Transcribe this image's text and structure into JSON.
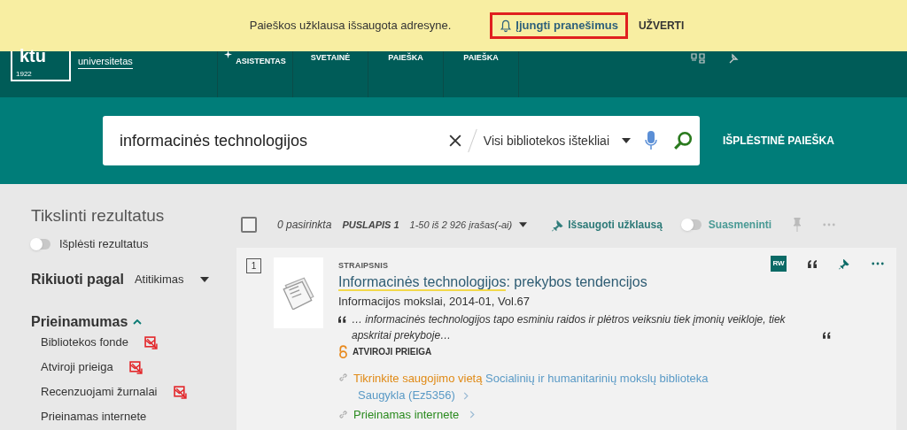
{
  "banner": {
    "message": "Paieškos užklausa išsaugota adresyne.",
    "notify_button": "Įjungti pranešimus",
    "close_button": "UŽVERTI"
  },
  "header": {
    "logo": "ktu",
    "logo_sub": "universitetas",
    "logo_year": "1922",
    "nav": [
      {
        "label": "ASISTENTAS",
        "kind": "sparkle"
      },
      {
        "label": "SVETAINĖ",
        "kind": "plain"
      },
      {
        "label": "PAIEŠKA",
        "kind": "plain"
      },
      {
        "label": "PAIEŠKA",
        "kind": "plain"
      }
    ]
  },
  "search": {
    "value": "informacinės technologijos",
    "scope": "Visi bibliotekos ištekliai",
    "advanced": "IŠPLĖSTINĖ PAIEŠKA"
  },
  "sidebar": {
    "title": "Tikslinti rezultatus",
    "expand": {
      "label": "Išplėsti rezultatus",
      "on": false
    },
    "sort": {
      "label": "Rikiuoti pagal",
      "value": "Atitikimas"
    },
    "availability": {
      "title": "Prieinamumas",
      "expanded": true,
      "items": [
        {
          "label": "Bibliotekos fonde",
          "exclude": true
        },
        {
          "label": "Atviroji prieiga",
          "exclude": true
        },
        {
          "label": "Recenzuojami žurnalai",
          "exclude": true
        },
        {
          "label": "Prieinamas internete",
          "exclude": false
        }
      ]
    }
  },
  "toolbar": {
    "checked": false,
    "selected_count": "0 pasirinkta",
    "page": "PUSLAPIS 1",
    "range": "1-50 iš 2 926 įrašas(-ai)",
    "save_query": "Išsaugoti užklausą",
    "personalize": {
      "label": "Suasmeninti",
      "on": false
    }
  },
  "results": [
    {
      "number": "1",
      "type": "STRAIPSNIS",
      "title_match": "Informacinės technologijos",
      "title_rest": ": prekybos tendencijos",
      "source": "Informacijos mokslai, 2014-01, Vol.67",
      "snippet": "… informacinės technologijos tapo esminiu raidos ir plėtros veiksniu tiek įmonių veikloje, tiek apskritai prekyboje…",
      "badge": "RW",
      "access": "ATVIROJI PRIEIGA",
      "location_label": "Tikrinkite saugojimo vietą",
      "library": "Socialinių ir humanitarinių mokslų biblioteka",
      "shelf": "Saugykla (Ez5356)",
      "online": "Prieinamas internete"
    }
  ]
}
